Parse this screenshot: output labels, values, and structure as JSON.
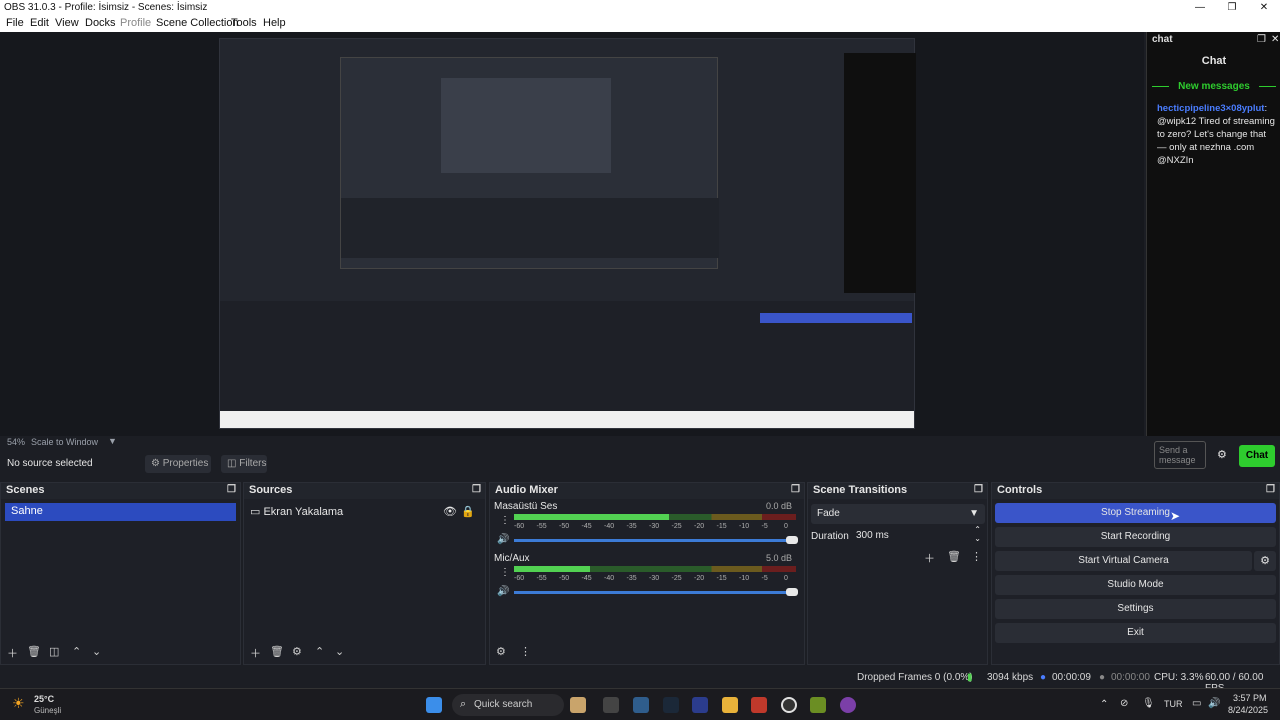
{
  "window": {
    "title": "OBS 31.0.3 - Profile: İsimsiz - Scenes: İsimsiz"
  },
  "menu": [
    "File",
    "Edit",
    "View",
    "Docks",
    "Profile",
    "Scene Collection",
    "Tools",
    "Help"
  ],
  "preview": {
    "scale_label": "54%",
    "scale_mode": "Scale to Window"
  },
  "chat": {
    "dock_title": "chat",
    "header": "Chat",
    "new_messages": "New messages",
    "username": "hecticpipeline3×08yplut",
    "message": "@wipk12 Tired of streaming to zero? Let's change that — only at nezhna .com @NXZIn",
    "send_placeholder": "Send a message",
    "chat_button": "Chat"
  },
  "source_toolbar": {
    "no_source": "No source selected",
    "properties": "Properties",
    "filters": "Filters"
  },
  "scenes": {
    "title": "Scenes",
    "items": [
      "Sahne"
    ]
  },
  "sources": {
    "title": "Sources",
    "items": [
      "Ekran Yakalama"
    ]
  },
  "audio_mixer": {
    "title": "Audio Mixer",
    "channels": [
      {
        "name": "Masaüstü Ses",
        "db": "0.0 dB",
        "level": 0.55
      },
      {
        "name": "Mic/Aux",
        "db": "5.0 dB",
        "level": 0.27
      }
    ],
    "ticks": [
      "-60",
      "-55",
      "-50",
      "-45",
      "-40",
      "-35",
      "-30",
      "-25",
      "-20",
      "-15",
      "-10",
      "-5",
      "0"
    ]
  },
  "transitions": {
    "title": "Scene Transitions",
    "selected": "Fade",
    "duration_label": "Duration",
    "duration_value": "300 ms"
  },
  "controls": {
    "title": "Controls",
    "buttons": [
      "Stop Streaming",
      "Start Recording",
      "Start Virtual Camera",
      "Studio Mode",
      "Settings",
      "Exit"
    ]
  },
  "status": {
    "dropped_frames": "Dropped Frames 0 (0.0%)",
    "bitrate": "3094 kbps",
    "stream_time": "00:00:09",
    "rec_time": "00:00:00",
    "cpu": "CPU: 3.3%",
    "fps": "60.00 / 60.00 FPS"
  },
  "taskbar": {
    "weather_temp": "25°C",
    "weather_desc": "Güneşli",
    "search": "Quick search",
    "lang": "TUR",
    "time": "3:57 PM",
    "date": "8/24/2025"
  },
  "colors": {
    "accent": "#3a55c9",
    "chat_green": "#2ecc2e",
    "window_bg": "#1c1e24"
  }
}
